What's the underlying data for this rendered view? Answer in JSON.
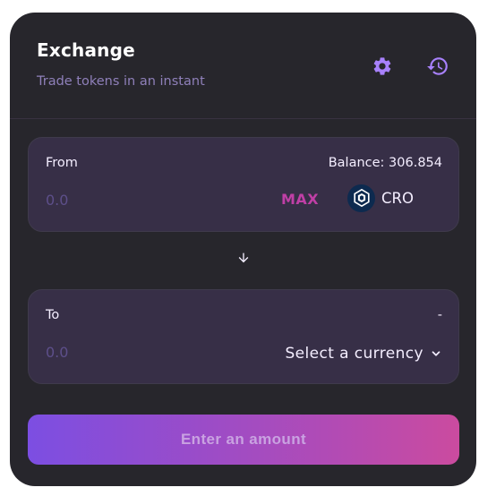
{
  "header": {
    "title": "Exchange",
    "subtitle": "Trade tokens in an instant",
    "settings_icon": "gear-icon",
    "history_icon": "history-icon"
  },
  "from_panel": {
    "label": "From",
    "balance": "Balance: 306.854",
    "amount_placeholder": "0.0",
    "max_label": "MAX",
    "token_icon": "cro-logo-icon",
    "token_symbol": "CRO"
  },
  "swap_arrow_icon": "arrow-down-icon",
  "to_panel": {
    "label": "To",
    "right_text": "-",
    "amount_placeholder": "0.0",
    "select_label": "Select a currency",
    "select_icon": "chevron-down-icon"
  },
  "submit": {
    "label": "Enter an amount"
  },
  "colors": {
    "card_bg": "#27262c",
    "panel_bg": "#372f47",
    "accent_purple": "#8f80ba",
    "max_pink": "#c03fa6",
    "button_gradient_start": "#7c4ee2",
    "button_gradient_end": "#cb4b9f"
  }
}
